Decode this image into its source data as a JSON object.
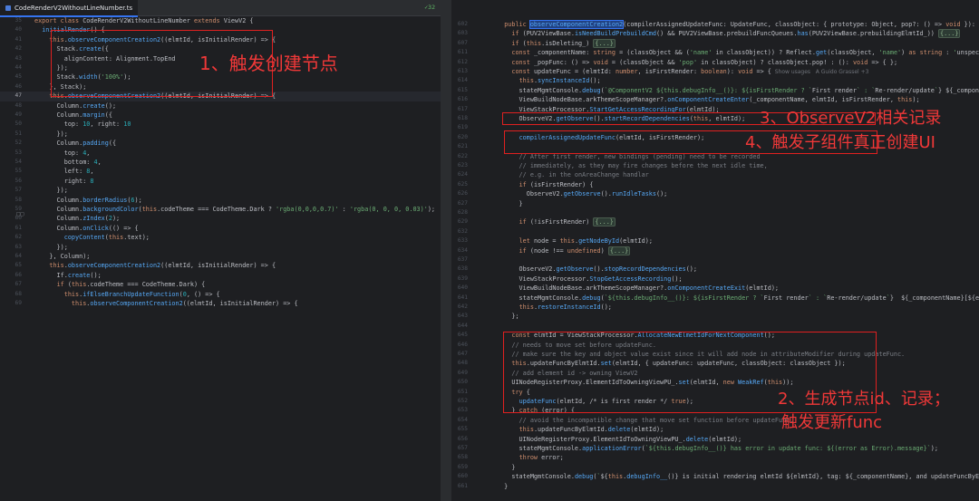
{
  "left": {
    "tab_label": "CodeRenderV2WithoutLineNumber.ts",
    "inspection": "32",
    "lines": [
      {
        "n": "35",
        "t": "export class CodeRenderV2WithoutLineNumber extends ViewV2 {"
      },
      {
        "n": "40",
        "t": "  initialRender() {"
      },
      {
        "n": "41",
        "t": "    this.observeComponentCreation2((elmtId, isInitialRender) => {"
      },
      {
        "n": "42",
        "t": "      Stack.create({"
      },
      {
        "n": "43",
        "t": "        alignContent: Alignment.TopEnd"
      },
      {
        "n": "44",
        "t": "      });"
      },
      {
        "n": "45",
        "t": "      Stack.width('100%');"
      },
      {
        "n": "46",
        "t": "    }, Stack);"
      },
      {
        "n": "47",
        "t": "    this.observeComponentCreation2((elmtId, isInitialRender) => {"
      },
      {
        "n": "48",
        "t": "      Column.create();"
      },
      {
        "n": "49",
        "t": "      Column.margin({"
      },
      {
        "n": "50",
        "t": "        top: 10, right: 10"
      },
      {
        "n": "51",
        "t": "      });"
      },
      {
        "n": "52",
        "t": "      Column.padding({"
      },
      {
        "n": "53",
        "t": "        top: 4,"
      },
      {
        "n": "54",
        "t": "        bottom: 4,"
      },
      {
        "n": "55",
        "t": "        left: 8,"
      },
      {
        "n": "56",
        "t": "        right: 8"
      },
      {
        "n": "57",
        "t": "      });"
      },
      {
        "n": "58",
        "t": "      Column.borderRadius(6);"
      },
      {
        "n": "59",
        "t": "      Column.backgroundColor(this.codeTheme === CodeTheme.Dark ? 'rgba(0,0,0,0.7)' : 'rgba(0, 0, 0, 0.03)');"
      },
      {
        "n": "60",
        "t": "      Column.zIndex(2);"
      },
      {
        "n": "61",
        "t": "      Column.onClick(() => {"
      },
      {
        "n": "62",
        "t": "        copyContent(this.text);"
      },
      {
        "n": "63",
        "t": "      });"
      },
      {
        "n": "64",
        "t": "    }, Column);"
      },
      {
        "n": "65",
        "t": "    this.observeComponentCreation2((elmtId, isInitialRender) => {"
      },
      {
        "n": "66",
        "t": "      If.create();"
      },
      {
        "n": "67",
        "t": "      if (this.codeTheme === CodeTheme.Dark) {"
      },
      {
        "n": "68",
        "t": "        this.ifElseBranchUpdateFunction(0, () => {"
      },
      {
        "n": "69",
        "t": "          this.observeComponentCreation2((elmtId, isInitialRender) => {"
      }
    ]
  },
  "right": {
    "lines": [
      {
        "n": "602",
        "t": "  public observeComponentCreation2(compilerAssignedUpdateFunc: UpdateFunc, classObject: { prototype: Object, pop?: () => void }): void {",
        "a": "Show"
      },
      {
        "n": "603",
        "t": "    if (PUV2ViewBase.isNeedBuildPrebuildCmd() && PUV2ViewBase.prebuildFuncQueues.has(PUV2ViewBase.prebuildingElmtId_)) {...}"
      },
      {
        "n": "607",
        "t": "    if (this.isDeleting_) {...}"
      },
      {
        "n": "611",
        "t": "    const _componentName: string = (classObject && ('name' in classObject)) ? Reflect.get(classObject, 'name') as string : 'unspecified UINo"
      },
      {
        "n": "612",
        "t": "    const _popFunc: () => void = (classObject && 'pop' in classObject) ? classObject.pop! : (): void => { };"
      },
      {
        "n": "613",
        "t": "    const updateFunc = (elmtId: number, isFirstRender: boolean): void => {",
        "a": "Show usages   A Guido Grassel +3"
      },
      {
        "n": "614",
        "t": "      this.syncInstanceId();"
      },
      {
        "n": "615",
        "t": "      stateMgmtConsole.debug(`@ComponentV2 ${this.debugInfo__()}: ${isFirstRender ? `First render` : `Re-render/update`} ${_componentName}"
      },
      {
        "n": "616",
        "t": "      ViewBuildNodeBase.arkThemeScopeManager?.onComponentCreateEnter(_componentName, elmtId, isFirstRender, this);"
      },
      {
        "n": "617",
        "t": "      ViewStackProcessor.StartGetAccessRecordingFor(elmtId);"
      },
      {
        "n": "618",
        "t": "      ObserveV2.getObserve().startRecordDependencies(this, elmtId);"
      },
      {
        "n": "619",
        "t": ""
      },
      {
        "n": "620",
        "t": "      compilerAssignedUpdateFunc(elmtId, isFirstRender);"
      },
      {
        "n": "621",
        "t": ""
      },
      {
        "n": "622",
        "t": "      // After first render, new bindings (pending) need to be recorded"
      },
      {
        "n": "623",
        "t": "      // immediately, as they may fire changes before the next idle time,"
      },
      {
        "n": "624",
        "t": "      // e.g. in the onAreaChange handlar"
      },
      {
        "n": "625",
        "t": "      if (isFirstRender) {"
      },
      {
        "n": "626",
        "t": "        ObserveV2.getObserve().runIdleTasks();"
      },
      {
        "n": "627",
        "t": "      }"
      },
      {
        "n": "628",
        "t": ""
      },
      {
        "n": "629",
        "t": "      if (!isFirstRender) {...}"
      },
      {
        "n": "632",
        "t": ""
      },
      {
        "n": "633",
        "t": "      let node = this.getNodeById(elmtId);"
      },
      {
        "n": "634",
        "t": "      if (node !== undefined) {...}"
      },
      {
        "n": "637",
        "t": ""
      },
      {
        "n": "638",
        "t": "      ObserveV2.getObserve().stopRecordDependencies();"
      },
      {
        "n": "639",
        "t": "      ViewStackProcessor.StopGetAccessRecording();"
      },
      {
        "n": "640",
        "t": "      ViewBuildNodeBase.arkThemeScopeManager?.onComponentCreateExit(elmtId);"
      },
      {
        "n": "641",
        "t": "      stateMgmtConsole.debug(`${this.debugInfo__()}: ${isFirstRender ? `First render` : `Re-render/update`}  ${_componentName}[${elmtId}]"
      },
      {
        "n": "642",
        "t": "      this.restoreInstanceId();"
      },
      {
        "n": "643",
        "t": "    };"
      },
      {
        "n": "644",
        "t": ""
      },
      {
        "n": "645",
        "t": "    const elmtId = ViewStackProcessor.AllocateNewElmetIdForNextComponent();"
      },
      {
        "n": "646",
        "t": "    // needs to move set before updateFunc."
      },
      {
        "n": "647",
        "t": "    // make sure the key and object value exist since it will add node in attributeModifier during updateFunc."
      },
      {
        "n": "648",
        "t": "    this.updateFuncByElmtId.set(elmtId, { updateFunc: updateFunc, classObject: classObject });"
      },
      {
        "n": "649",
        "t": "    // add element id -> owning ViewV2"
      },
      {
        "n": "650",
        "t": "    UINodeRegisterProxy.ElementIdToOwningViewPU_.set(elmtId, new WeakRef(this));"
      },
      {
        "n": "651",
        "t": "    try {"
      },
      {
        "n": "652",
        "t": "      updateFunc(elmtId, /* is first render */ true);"
      },
      {
        "n": "653",
        "t": "    } catch (error) {"
      },
      {
        "n": "654",
        "t": "      // avoid the incompatible change that move set function before updateFunc."
      },
      {
        "n": "655",
        "t": "      this.updateFuncByElmtId.delete(elmtId);"
      },
      {
        "n": "656",
        "t": "      UINodeRegisterProxy.ElementIdToOwningViewPU_.delete(elmtId);"
      },
      {
        "n": "657",
        "t": "      stateMgmtConsole.applicationError(`${this.debugInfo__()} has error in update func: ${(error as Error).message}`);"
      },
      {
        "n": "658",
        "t": "      throw error;"
      },
      {
        "n": "659",
        "t": "    }"
      },
      {
        "n": "660",
        "t": "    stateMgmtConsole.debug(`${this.debugInfo__()} is initial rendering elmtId ${elmtId}, tag: ${_componentName}, and updateFuncByElmtId size"
      },
      {
        "n": "661",
        "t": "  }"
      }
    ]
  },
  "annotations": {
    "a1": "1、触发创建节点",
    "a2_line1": "2、生成节点id、记录；",
    "a2_line2": "触发更新func",
    "a3": "3、ObserveV2相关记录",
    "a4": "4、触发子组件真正创建UI"
  },
  "colors": {
    "annotation": "#f03838",
    "background": "#1e1f22",
    "keyword": "#cf8e6d",
    "function": "#56a8f5",
    "string": "#6aab73",
    "number": "#2aacb8"
  }
}
